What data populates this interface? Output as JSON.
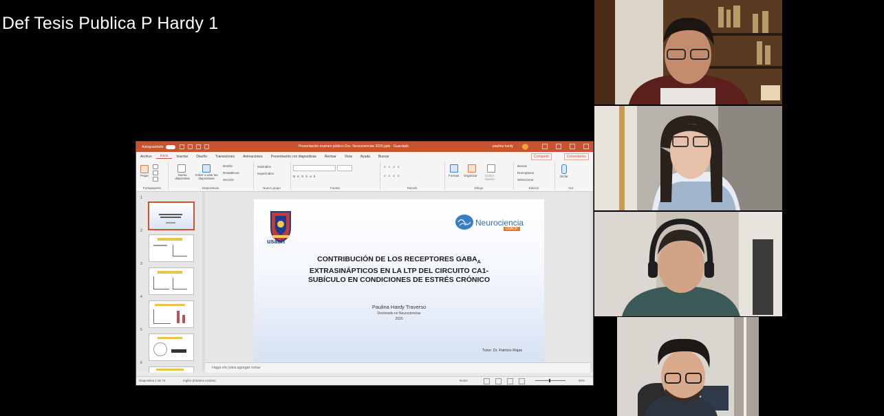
{
  "video": {
    "title": "Def Tesis Publica P Hardy 1"
  },
  "powerpoint": {
    "titlebar": {
      "autosave_label": "Autoguardado",
      "document_title": "Presentación examen público Dvc. Neurociencias 2020.pptx · Guardado",
      "user": "paulina hardy"
    },
    "tabs": [
      "Archivo",
      "Inicio",
      "Insertar",
      "Diseño",
      "Transiciones",
      "Animaciones",
      "Presentación con diapositivas",
      "Revisar",
      "Vista",
      "Ayuda",
      "Buscar"
    ],
    "active_tab": "Inicio",
    "share_label": "Compartir",
    "comments_label": "Comentarios",
    "ribbon": {
      "paste": "Pegar",
      "new_slide": "Nueva diapositiva",
      "reuse": "Volver a usar las diapositivas",
      "layout": "Diseño",
      "reset": "Restablecer",
      "section": "Sección",
      "subtitle": "Subíndice",
      "superscript": "Superíndice",
      "shapes": "Formas",
      "arrange": "Organizar",
      "quick_styles": "Estilos rápidos",
      "find": "Buscar",
      "replace": "Reemplazar",
      "select": "Seleccionar",
      "dictate": "Dictar",
      "groups": [
        "Portapapeles",
        "Diapositivas",
        "Nuevo grupo",
        "Fuente",
        "Párrafo",
        "Dibujo",
        "Edición",
        "Voz"
      ]
    },
    "thumbnail_numbers": [
      "1",
      "2",
      "3",
      "4",
      "5",
      "6"
    ],
    "slide": {
      "logo_left_text": "usach",
      "logo_right_text": "Neurociencia",
      "logo_right_badge": "USACH",
      "title_line1": "CONTRIBUCIÓN DE LOS RECEPTORES GABA",
      "title_sub": "A",
      "title_line2": "EXTRASINÁPTICOS EN LA LTP DEL CIRCUITO CA1-",
      "title_line3": "SUBÍCULO EN CONDICIONES DE ESTRÉS CRÓNICO",
      "author": "Paulina Hardy Traverso",
      "degree": "Doctorado en Neurociencias",
      "year": "2020",
      "tutor": "Tutor: Dr. Patricio Rojas"
    },
    "notes_placeholder": "Haga clic para agregar notas",
    "status": {
      "slide_counter": "Diapositiva 1 de 74",
      "language": "Inglés (Estados Unidos)",
      "notes_button": "Notas",
      "zoom": "60%"
    }
  },
  "participants": [
    {
      "id": "participant-1"
    },
    {
      "id": "participant-2"
    },
    {
      "id": "participant-3"
    },
    {
      "id": "participant-4"
    }
  ],
  "colors": {
    "powerpoint_accent": "#c7532f",
    "background": "#000000"
  }
}
